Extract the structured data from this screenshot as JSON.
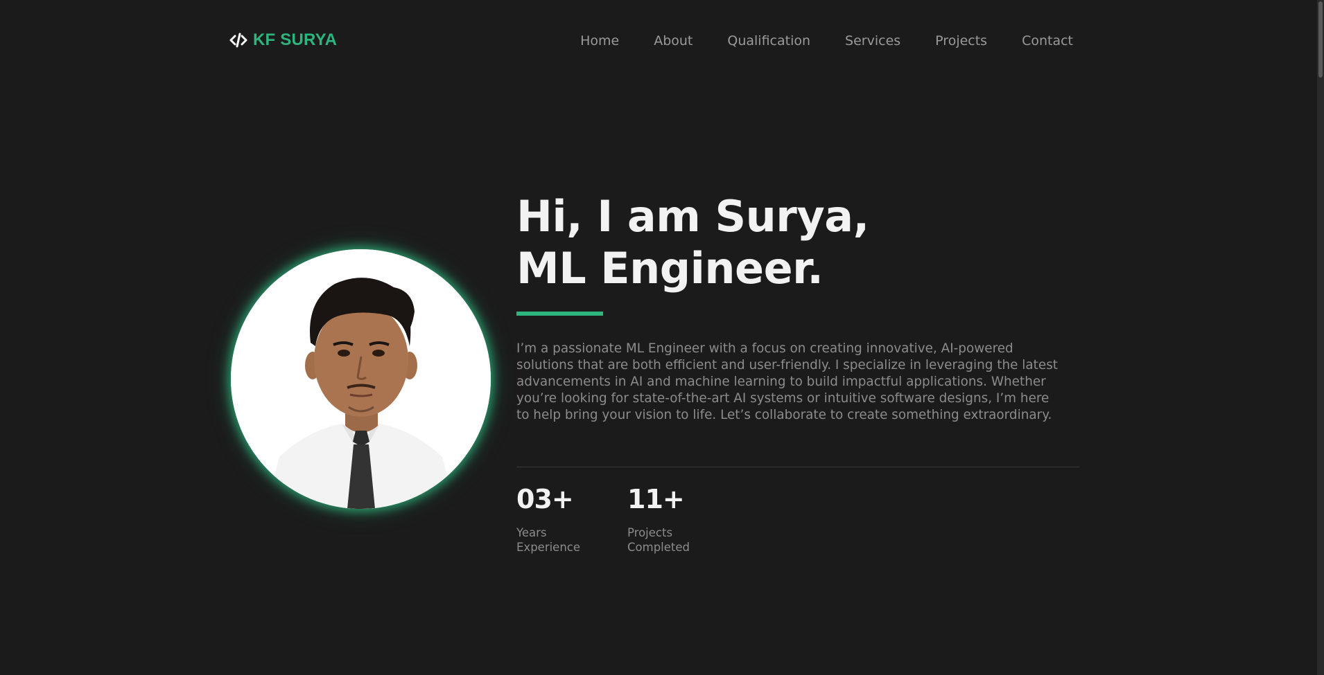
{
  "header": {
    "logo_icon": "code-brackets-icon",
    "logo_text": "KF SURYA",
    "nav": [
      "Home",
      "About",
      "Qualification",
      "Services",
      "Projects",
      "Contact"
    ]
  },
  "hero": {
    "title_line1": "Hi, I am Surya,",
    "title_line2": "ML Engineer.",
    "description": "I’m a passionate ML Engineer with a focus on creating innovative, AI-powered solutions that are both efficient and user-friendly. I specialize in leveraging the latest advancements in AI and machine learning to build impactful applications. Whether you’re looking for state-of-the-art AI systems or intuitive software designs, I’m here to help bring your vision to life. Let’s collaborate to create something extraordinary.",
    "stats": [
      {
        "value": "03+",
        "label_line1": "Years",
        "label_line2": "Experience"
      },
      {
        "value": "11+",
        "label_line1": "Projects",
        "label_line2": "Completed"
      }
    ]
  },
  "colors": {
    "background": "#1b1b1b",
    "accent": "#2eb57e",
    "heading": "#f2f2f2",
    "muted": "#8c8c8c"
  }
}
